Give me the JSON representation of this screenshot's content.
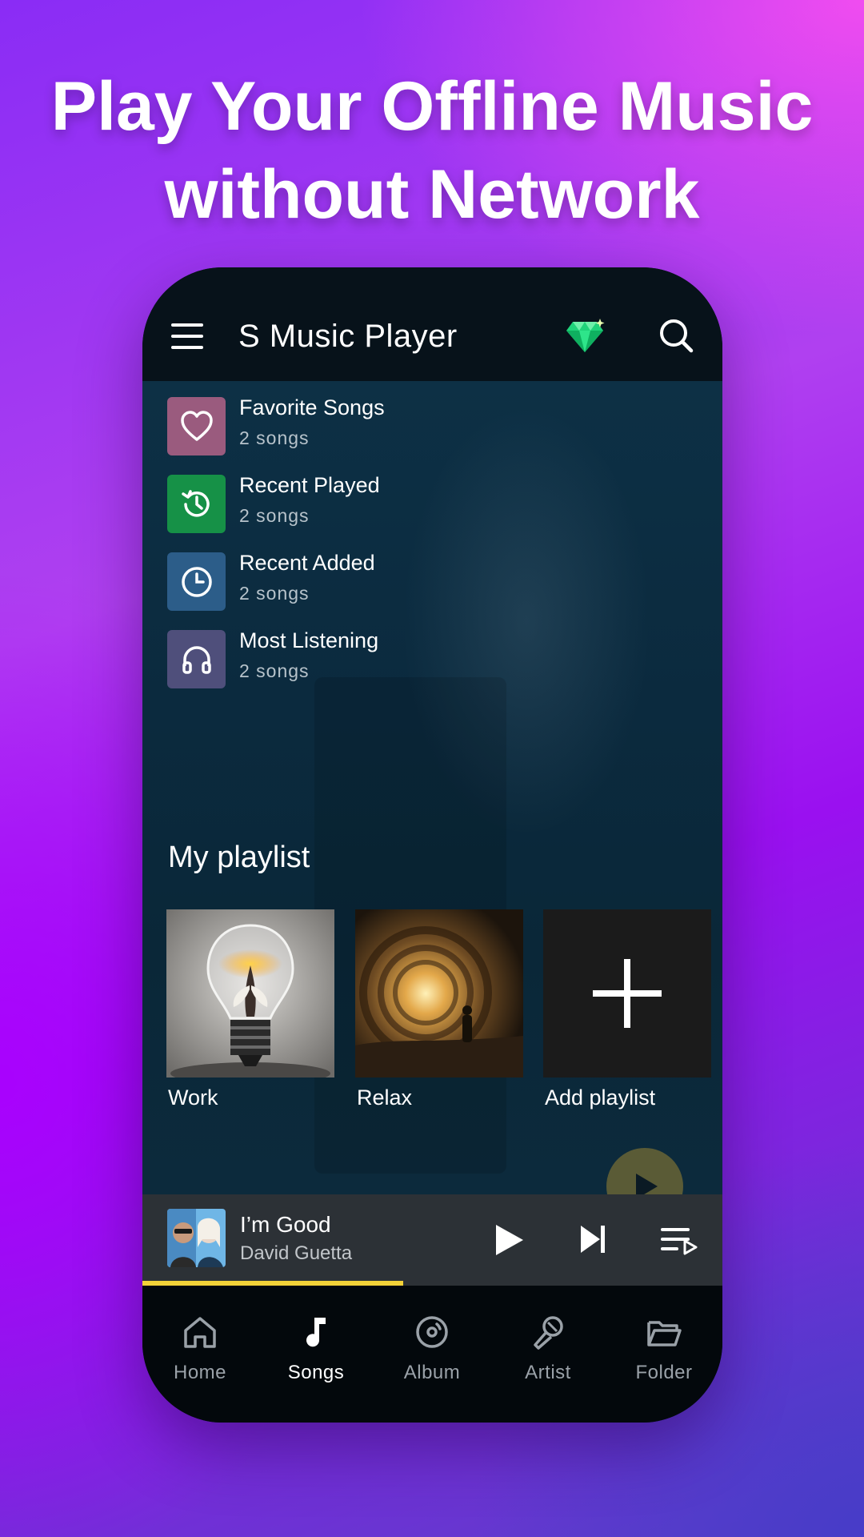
{
  "headline": {
    "line1": "Play Your Offline Music",
    "line2": "without Network"
  },
  "appbar": {
    "title": "S Music Player",
    "menu_icon": "hamburger-menu-icon",
    "premium_icon": "diamond-icon",
    "search_icon": "search-icon"
  },
  "categories": [
    {
      "title": "Favorite Songs",
      "subtitle": "2 songs",
      "icon": "heart-icon",
      "color": "#9a5b7e"
    },
    {
      "title": "Recent Played",
      "subtitle": "2 songs",
      "icon": "history-icon",
      "color": "#169147"
    },
    {
      "title": "Recent Added",
      "subtitle": "2 songs",
      "icon": "clock-icon",
      "color": "#2c5d89"
    },
    {
      "title": "Most Listening",
      "subtitle": "2 songs",
      "icon": "headphones-icon",
      "color": "#4f4f7b"
    }
  ],
  "playlist_section": {
    "title": "My playlist",
    "items": [
      {
        "label": "Work"
      },
      {
        "label": "Relax"
      },
      {
        "label": "Add playlist"
      }
    ]
  },
  "now_playing": {
    "title": "I’m Good",
    "artist": "David Guetta",
    "progress": 0.45,
    "accent": "#f3d238"
  },
  "bottom_nav": {
    "active": "Songs",
    "items": [
      {
        "label": "Home",
        "icon": "home-icon"
      },
      {
        "label": "Songs",
        "icon": "music-note-icon"
      },
      {
        "label": "Album",
        "icon": "album-disc-icon"
      },
      {
        "label": "Artist",
        "icon": "microphone-icon"
      },
      {
        "label": "Folder",
        "icon": "folder-icon"
      }
    ]
  }
}
